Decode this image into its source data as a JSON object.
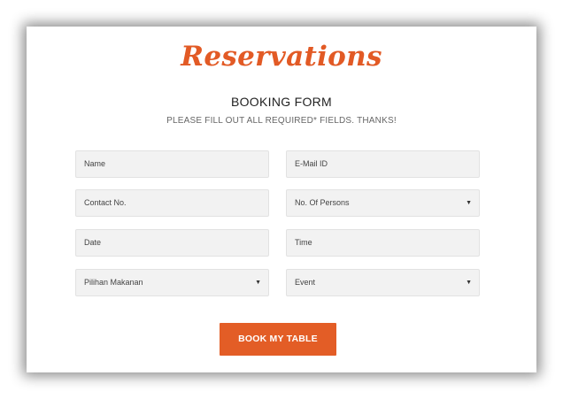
{
  "brand": {
    "title": "Reservations"
  },
  "form": {
    "title": "BOOKING FORM",
    "subtitle": "PLEASE FILL OUT ALL REQUIRED* FIELDS. THANKS!",
    "name_placeholder": "Name",
    "email_placeholder": "E-Mail ID",
    "contact_placeholder": "Contact No.",
    "persons_selected": "No. Of Persons",
    "date_placeholder": "Date",
    "time_placeholder": "Time",
    "food_selected": "Pilihan Makanan",
    "event_selected": "Event",
    "submit_label": "BOOK MY TABLE"
  },
  "colors": {
    "accent": "#e35d26",
    "field_bg": "#f2f2f2"
  },
  "icons": {
    "dropdown": "chevron-down-icon"
  }
}
